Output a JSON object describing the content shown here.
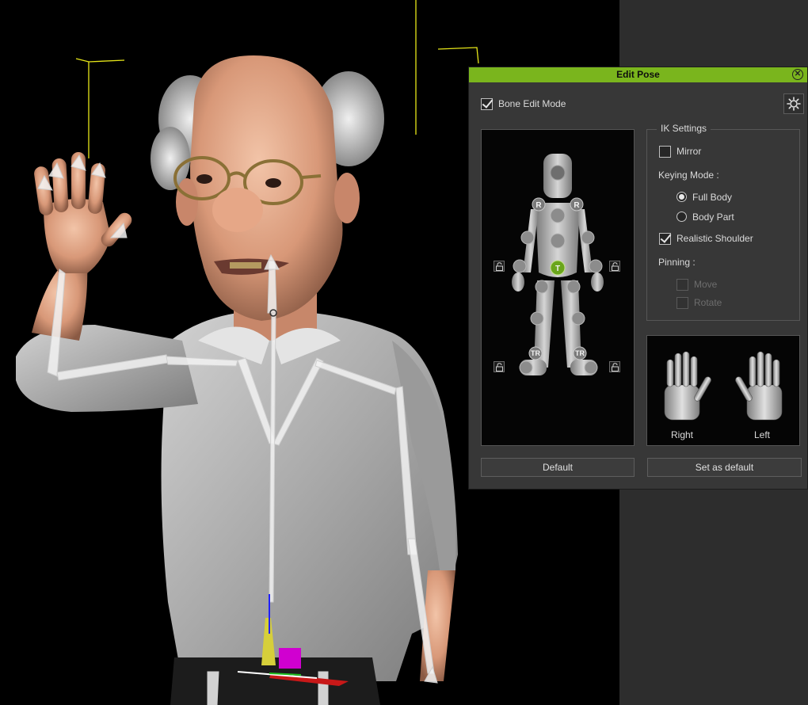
{
  "panel": {
    "title": "Edit Pose",
    "bone_edit_mode": {
      "label": "Bone Edit Mode",
      "checked": true
    },
    "ik_settings": {
      "legend": "IK Settings",
      "mirror": {
        "label": "Mirror",
        "checked": false
      },
      "keying_mode_label": "Keying Mode :",
      "keying_options": [
        {
          "label": "Full Body",
          "selected": true
        },
        {
          "label": "Body Part",
          "selected": false
        }
      ],
      "realistic_shoulder": {
        "label": "Realistic Shoulder",
        "checked": true
      },
      "pinning_label": "Pinning :",
      "pin_move": {
        "label": "Move",
        "enabled": false
      },
      "pin_rotate": {
        "label": "Rotate",
        "enabled": false
      }
    },
    "body_markers": {
      "rotate": "R",
      "translate": "T",
      "translate_rotate": "TR"
    },
    "hands": {
      "right_label": "Right",
      "left_label": "Left"
    },
    "buttons": {
      "default_label": "Default",
      "set_default_label": "Set as default"
    },
    "icons": {
      "close": "close-icon",
      "settings": "gear-icon",
      "lock": "lock-icon"
    }
  },
  "colors": {
    "title_bar": "#7ab51d",
    "active_joint": "#6aa51c",
    "panel_bg": "#373737",
    "sidebar_bg": "#2d2d2d"
  }
}
